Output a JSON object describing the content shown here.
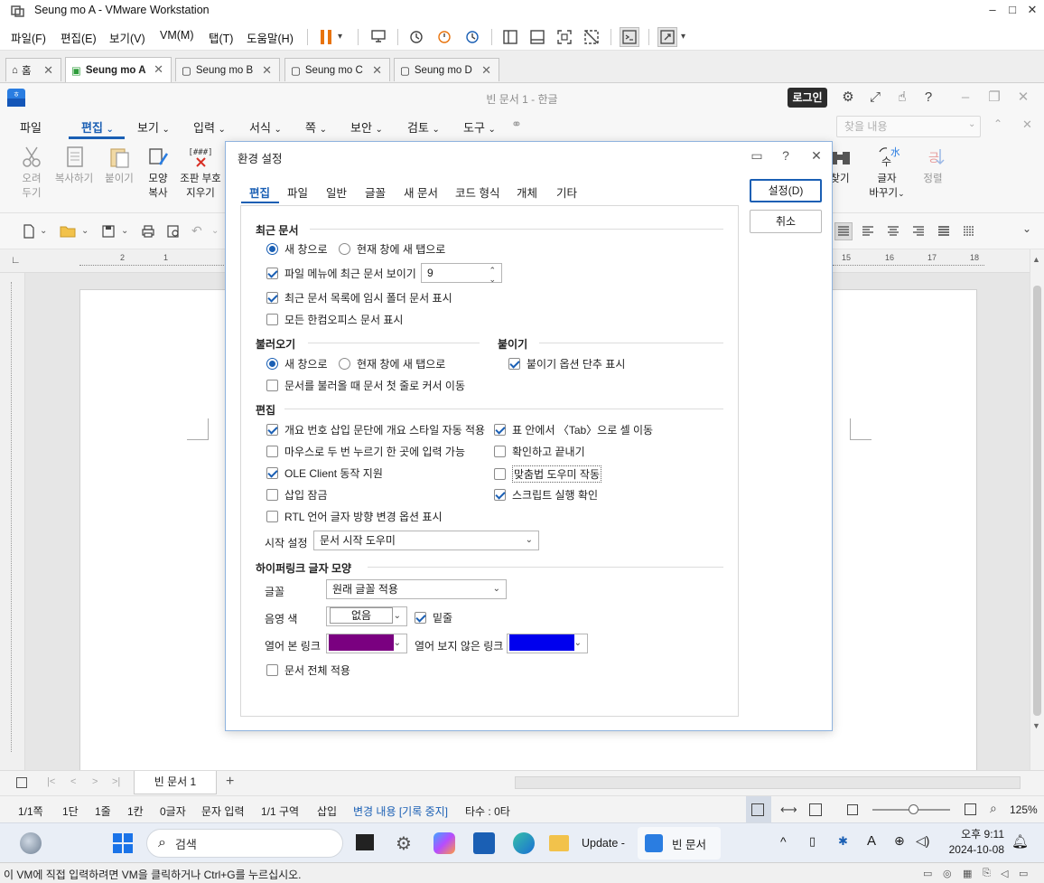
{
  "vmware": {
    "title": "Seung mo A - VMware Workstation",
    "menu": [
      "파일(F)",
      "편집(E)",
      "보기(V)",
      "VM(M)",
      "탭(T)",
      "도움말(H)"
    ],
    "tabs": [
      {
        "label": "홈"
      },
      {
        "label": "Seung mo A"
      },
      {
        "label": "Seung mo B"
      },
      {
        "label": "Seung mo C"
      },
      {
        "label": "Seung mo D"
      }
    ],
    "status_message": "이 VM에 직접 입력하려면 VM을 클릭하거나 Ctrl+G를 누르십시오."
  },
  "hwp": {
    "title": "빈 문서 1 - 한글",
    "login_label": "로그인",
    "menu_tabs": [
      "파일",
      "편집",
      "보기",
      "입력",
      "서식",
      "쪽",
      "보안",
      "검토",
      "도구"
    ],
    "search_placeholder": "찾을 내용",
    "ribbon_left": [
      {
        "line1": "오려",
        "line2": "두기"
      },
      {
        "line1": "복사하기",
        "line2": ""
      },
      {
        "line1": "붙이기",
        "line2": ""
      },
      {
        "line1": "모양",
        "line2": "복사"
      },
      {
        "line1": "조판 부호",
        "line2": "지우기"
      }
    ],
    "ribbon_right": [
      {
        "line1": "찾기",
        "line2": ""
      },
      {
        "line1": "글자",
        "line2": "바꾸기"
      },
      {
        "line1": "정렬",
        "line2": ""
      }
    ],
    "ruler_left": [
      "2",
      "1"
    ],
    "ruler_right": [
      "15",
      "16",
      "17",
      "18"
    ],
    "doc_tab": "빈 문서 1",
    "status": {
      "page": "1/1쪽",
      "column": "1단",
      "line": "1줄",
      "col": "1칸",
      "chars": "0글자",
      "mode": "문자 입력",
      "section": "1/1 구역",
      "insert": "삽입",
      "track": "변경 내용 [기록 중지]",
      "keystrokes": "타수 : 0타",
      "zoom": "125%"
    }
  },
  "dialog": {
    "title": "환경 설정",
    "tabs": [
      "편집",
      "파일",
      "일반",
      "글꼴",
      "새 문서",
      "코드 형식",
      "개체",
      "기타"
    ],
    "ok_label": "설정(D)",
    "cancel_label": "취소",
    "recent": {
      "heading": "최근 문서",
      "radio_new_window": "새 창으로",
      "radio_new_tab": "현재 창에 새 탭으로",
      "show_recent": "파일 메뉴에 최근 문서 보이기",
      "recent_count": "9",
      "show_temp": "최근 문서 목록에 임시 폴더 문서 표시",
      "show_all": "모든 한컴오피스 문서 표시"
    },
    "open": {
      "heading": "불러오기",
      "radio_new_window": "새 창으로",
      "radio_new_tab": "현재 창에 새 탭으로",
      "cursor_first_line": "문서를 불러올 때 문서 첫 줄로 커서 이동"
    },
    "paste": {
      "heading": "붙이기",
      "show_paste_button": "붙이기 옵션 단추 표시"
    },
    "edit": {
      "heading": "편집",
      "auto_outline": "개요 번호 삽입 문단에 개요 스타일 자동 적용",
      "tab_in_table": "표 안에서 〈Tab〉으로 셀 이동",
      "double_click_input": "마우스로 두 번 누르기 한 곳에 입력 가능",
      "confirm_exit": "확인하고 끝내기",
      "ole_client": "OLE Client 동작 지원",
      "spell_helper": "맞춤법 도우미 작동",
      "insert_lock": "삽입 잠금",
      "script_confirm": "스크립트 실행 확인",
      "rtl_option": "RTL 언어 글자 방향 변경 옵션 표시",
      "start_label": "시작 설정",
      "start_value": "문서 시작 도우미"
    },
    "hyperlink": {
      "heading": "하이퍼링크 글자 모양",
      "font_label": "글꼴",
      "font_value": "원래 글꼴 적용",
      "shade_label": "음영 색",
      "shade_value": "없음",
      "underline": "밑줄",
      "visited_label": "열어 본 링크",
      "visited_color": "#7a0080",
      "unvisited_label": "열어 보지 않은 링크",
      "unvisited_color": "#0000ee",
      "apply_all": "문서 전체 적용"
    }
  },
  "taskbar": {
    "search_label": "검색",
    "app_update": "Update -",
    "app_doc": "빈 문서",
    "time": "오후 9:11",
    "date": "2024-10-08"
  }
}
